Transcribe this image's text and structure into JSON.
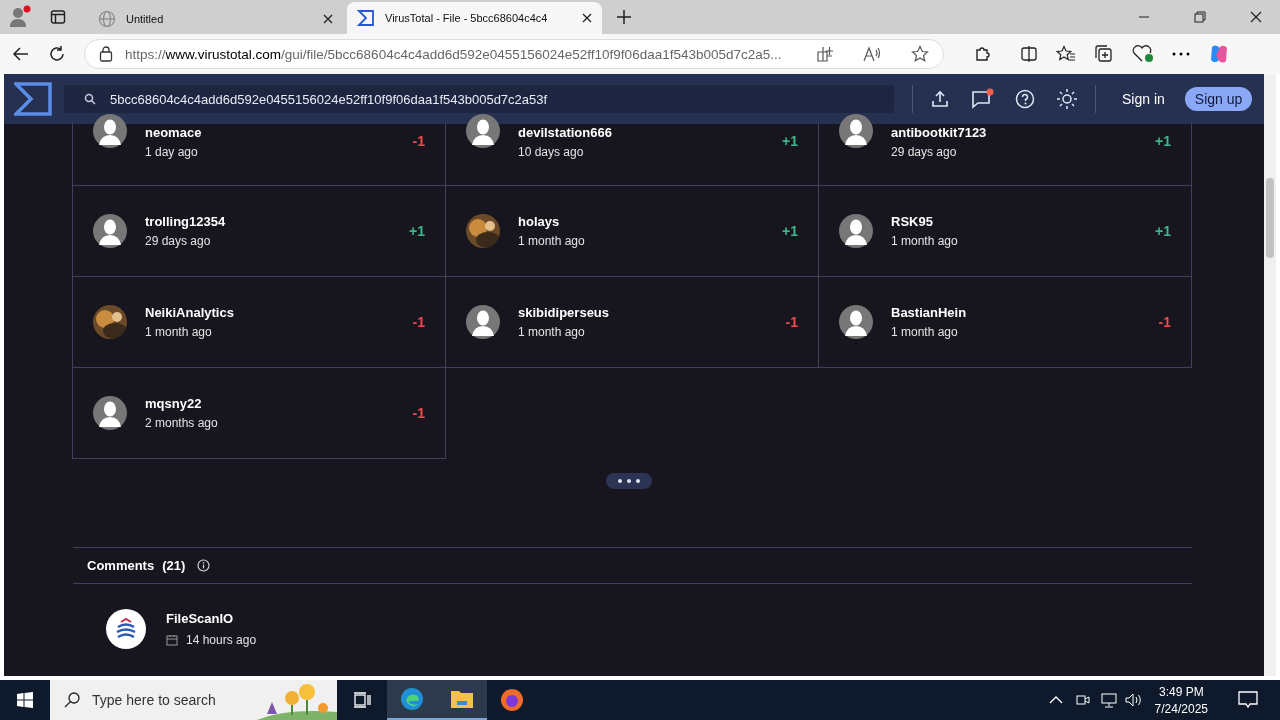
{
  "browser": {
    "tabs": [
      {
        "title": "Untitled",
        "selected": false,
        "kind": "globe"
      },
      {
        "title": "VirusTotal - File - 5bcc68604c4c4",
        "selected": true,
        "kind": "sigma"
      }
    ],
    "url_host": "https://www.virustotal.com",
    "url_path": "/gui/file/5bcc68604c4c4add6d592e0455156024e52ff10f9f06daa1f543b005d7c2a5..."
  },
  "header": {
    "search_value": "5bcc68604c4c4add6d592e0455156024e52ff10f9f06daa1f543b005d7c2a53f",
    "sign_in": "Sign in",
    "sign_up": "Sign up"
  },
  "votes": [
    {
      "user": "neomace",
      "time": "1 day ago",
      "vote": "-1",
      "kind": "down",
      "avatar": {
        "kind": "default"
      }
    },
    {
      "user": "devilstation666",
      "time": "10 days ago",
      "vote": "+1",
      "kind": "up",
      "avatar": {
        "kind": "default"
      }
    },
    {
      "user": "antibootkit7123",
      "time": "29 days ago",
      "vote": "+1",
      "kind": "up",
      "avatar": {
        "kind": "default"
      }
    },
    {
      "user": "trolling12354",
      "time": "29 days ago",
      "vote": "+1",
      "kind": "up",
      "avatar": {
        "kind": "default"
      }
    },
    {
      "user": "holays",
      "time": "1 month ago",
      "vote": "+1",
      "kind": "up"
    },
    {
      "user": "RSK95",
      "time": "1 month ago",
      "vote": "+1",
      "kind": "up",
      "avatar": {
        "kind": "default"
      }
    },
    {
      "user": "NeikiAnalytics",
      "time": "1 month ago",
      "vote": "-1",
      "kind": "down"
    },
    {
      "user": "skibidiperseus",
      "time": "1 month ago",
      "vote": "-1",
      "kind": "down",
      "avatar": {
        "kind": "default"
      }
    },
    {
      "user": "BastianHein",
      "time": "1 month ago",
      "vote": "-1",
      "kind": "down",
      "avatar": {
        "kind": "default"
      }
    },
    {
      "user": "mqsny22",
      "time": "2 months ago",
      "vote": "-1",
      "kind": "down",
      "avatar": {
        "kind": "default"
      }
    }
  ],
  "comments": {
    "title": "Comments",
    "count": "(21)",
    "items": [
      {
        "user": "FileScanIO",
        "time": "14 hours ago"
      }
    ]
  },
  "taskbar": {
    "search_placeholder": "Type here to search",
    "time": "3:49 PM",
    "date": "7/24/2025"
  }
}
